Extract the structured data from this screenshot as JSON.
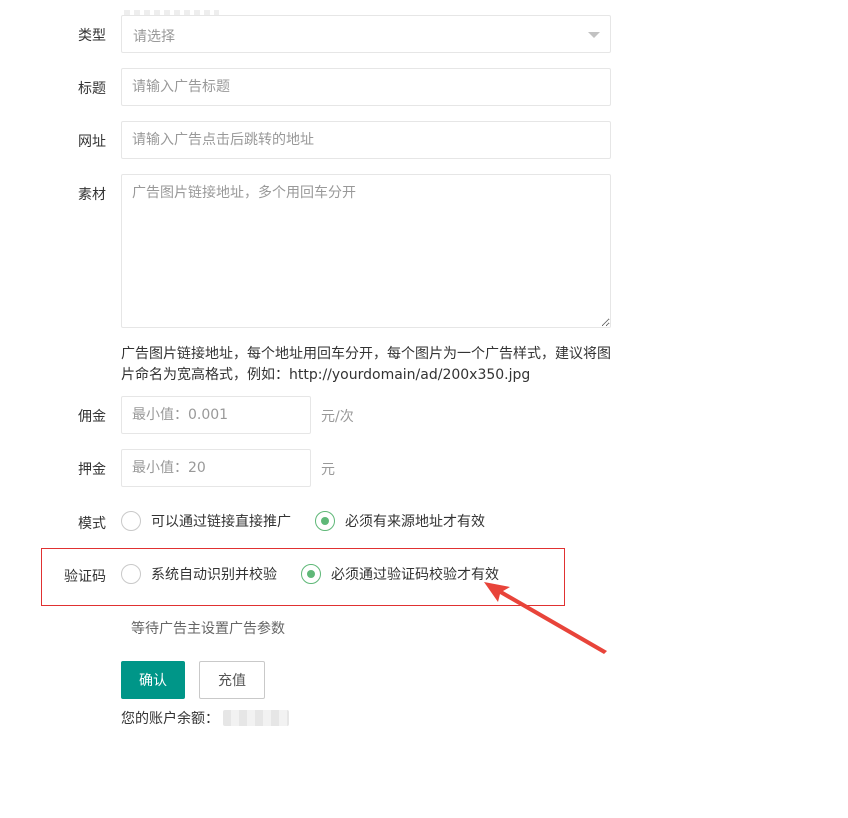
{
  "form": {
    "type": {
      "label": "类型",
      "placeholder": "请选择"
    },
    "title": {
      "label": "标题",
      "placeholder": "请输入广告标题"
    },
    "url": {
      "label": "网址",
      "placeholder": "请输入广告点击后跳转的地址"
    },
    "material": {
      "label": "素材",
      "placeholder": "广告图片链接地址，多个用回车分开",
      "hint": "广告图片链接地址，每个地址用回车分开，每个图片为一个广告样式，建议将图片命名为宽高格式，例如：http://yourdomain/ad/200x350.jpg"
    },
    "commission": {
      "label": "佣金",
      "placeholder": "最小值：0.001",
      "unit": "元/次"
    },
    "deposit": {
      "label": "押金",
      "placeholder": "最小值：20",
      "unit": "元"
    },
    "mode": {
      "label": "模式",
      "options": [
        {
          "label": "可以通过链接直接推广",
          "checked": false
        },
        {
          "label": "必须有来源地址才有效",
          "checked": true
        }
      ]
    },
    "captcha": {
      "label": "验证码",
      "options": [
        {
          "label": "系统自动识别并校验",
          "checked": false
        },
        {
          "label": "必须通过验证码校验才有效",
          "checked": true
        }
      ]
    },
    "status_text": "等待广告主设置广告参数",
    "confirm_label": "确认",
    "recharge_label": "充值",
    "balance_label": "您的账户余额："
  },
  "colors": {
    "primary": "#009688",
    "radio_checked": "#5fb878",
    "highlight": "#e03131",
    "arrow": "#e8443a"
  }
}
